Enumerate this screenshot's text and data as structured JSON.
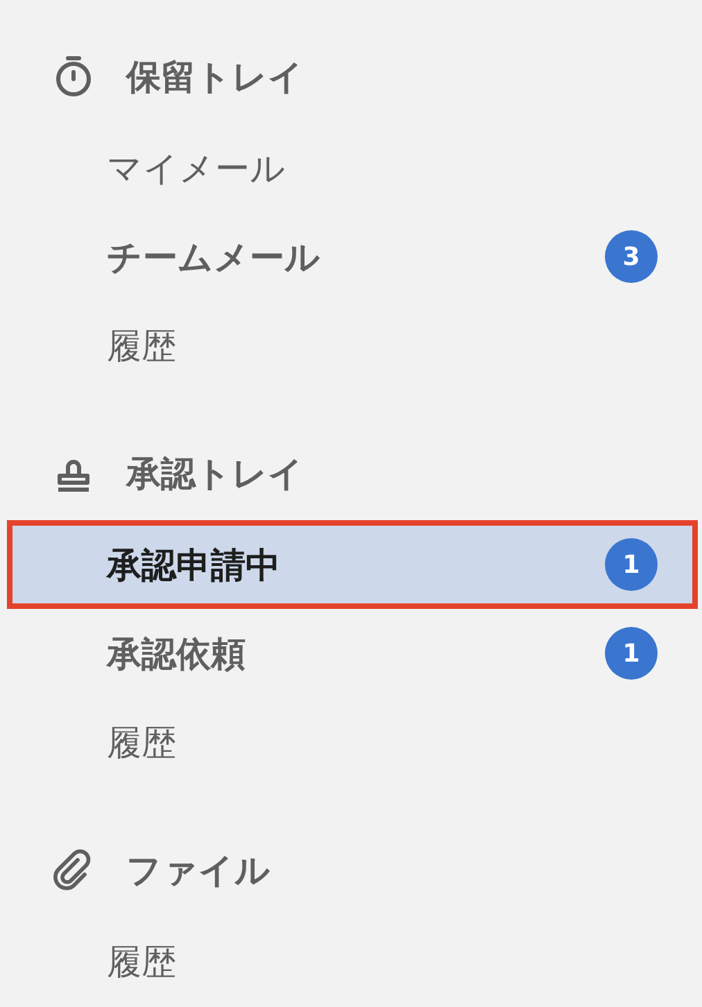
{
  "sections": [
    {
      "title": "保留トレイ",
      "items": [
        {
          "label": "マイメール",
          "unread": false,
          "selected": false
        },
        {
          "label": "チームメール",
          "unread": true,
          "selected": false,
          "badge": "3"
        },
        {
          "label": "履歴",
          "unread": false,
          "selected": false
        }
      ]
    },
    {
      "title": "承認トレイ",
      "items": [
        {
          "label": "承認申請中",
          "unread": true,
          "selected": true,
          "badge": "1"
        },
        {
          "label": "承認依頼",
          "unread": true,
          "selected": false,
          "badge": "1"
        },
        {
          "label": "履歴",
          "unread": false,
          "selected": false
        }
      ]
    },
    {
      "title": "ファイル",
      "items": [
        {
          "label": "履歴",
          "unread": false,
          "selected": false
        }
      ]
    }
  ]
}
